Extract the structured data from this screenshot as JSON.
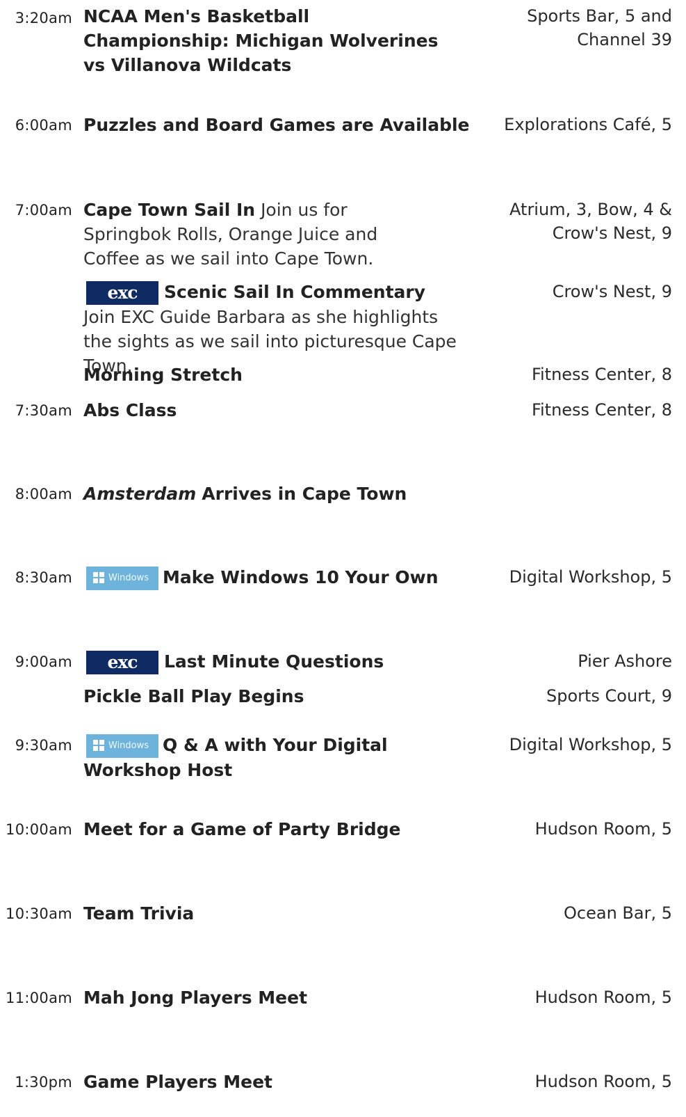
{
  "schedule": [
    {
      "time": "3:20am",
      "title": "NCAA Men's Basketball Championship: Michigan Wolverines vs Villanova Wildcats",
      "location": "Sports Bar, 5 and Channel 39"
    },
    {
      "time": "6:00am",
      "title": "Puzzles and Board Games are Available",
      "location": "Explorations Café, 5"
    },
    {
      "time": "7:00am",
      "title": "Cape Town Sail In",
      "description": "Join us for Springbok Rolls, Orange Juice and Coffee as we sail into Cape Town.",
      "location": "Atrium, 3, Bow, 4 & Crow's Nest, 9"
    },
    {
      "badge": "exc",
      "badge_text": "exc",
      "title": "Scenic Sail In Commentary",
      "description": "Join EXC Guide Barbara as she highlights the sights as we sail into picturesque Cape Town.",
      "location": "Crow's Nest, 9"
    },
    {
      "title": "Morning Stretch",
      "location": "Fitness Center, 8"
    },
    {
      "time": "7:30am",
      "title": "Abs Class",
      "location": "Fitness Center, 8"
    },
    {
      "time": "8:00am",
      "title_italic": "Amsterdam",
      "title": "Arrives in Cape Town"
    },
    {
      "time": "8:30am",
      "badge": "windows",
      "badge_text": "Windows",
      "title": "Make Windows 10 Your Own",
      "location": "Digital Workshop, 5"
    },
    {
      "time": "9:00am",
      "badge": "exc",
      "badge_text": "exc",
      "title": "Last Minute Questions",
      "location": "Pier Ashore"
    },
    {
      "title": "Pickle Ball Play Begins",
      "location": "Sports Court, 9"
    },
    {
      "time": "9:30am",
      "badge": "windows",
      "badge_text": "Windows",
      "title": "Q & A with Your Digital Workshop Host",
      "location": "Digital Workshop, 5"
    },
    {
      "time": "10:00am",
      "title": "Meet for a Game of Party Bridge",
      "location": "Hudson Room, 5"
    },
    {
      "time": "10:30am",
      "title": "Team Trivia",
      "location": "Ocean Bar, 5"
    },
    {
      "time": "11:00am",
      "title": "Mah Jong Players Meet",
      "location": "Hudson Room, 5"
    },
    {
      "time": "1:30pm",
      "title": "Game Players Meet",
      "location": "Hudson Room, 5"
    }
  ],
  "colors": {
    "exc_badge": "#102a63",
    "windows_badge": "#6db3dc",
    "text": "#222222"
  }
}
